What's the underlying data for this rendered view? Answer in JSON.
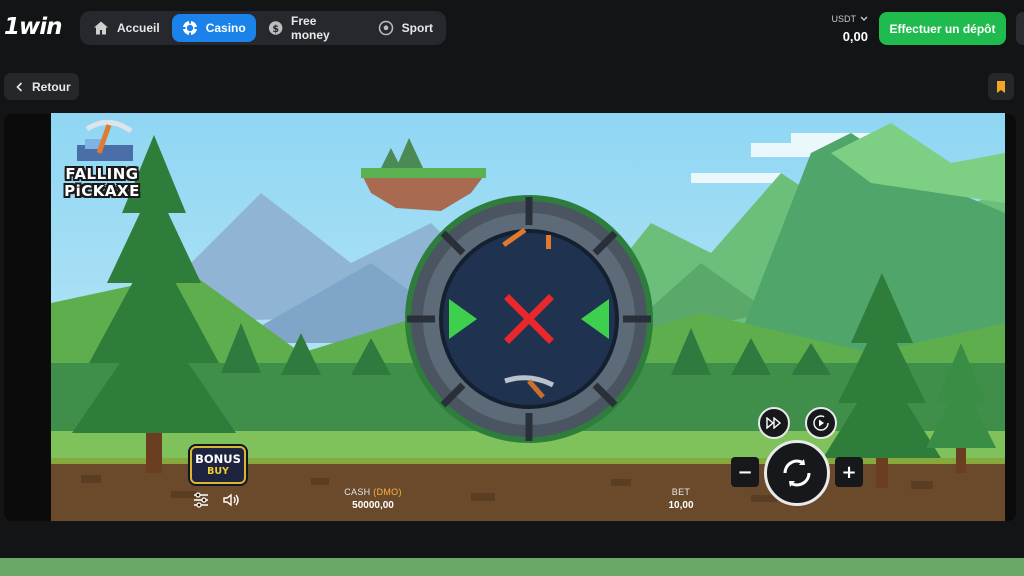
{
  "header": {
    "logo": "1win",
    "nav": [
      {
        "label": "Accueil",
        "icon": "home-icon",
        "active": false
      },
      {
        "label": "Casino",
        "icon": "casino-chip-icon",
        "active": true
      },
      {
        "label": "Free money",
        "icon": "dollar-coin-icon",
        "active": false
      },
      {
        "label": "Sport",
        "icon": "soccer-ball-icon",
        "active": false
      }
    ],
    "balance": {
      "currency": "USDT",
      "amount": "0,00"
    },
    "deposit_label": "Effectuer un dépôt"
  },
  "subbar": {
    "back_label": "Retour",
    "bookmark_icon": "bookmark-icon"
  },
  "game": {
    "logo_line1": "FALLING",
    "logo_line2": "PiCKAXE",
    "bonus_line1": "BONUS",
    "bonus_line2": "BUY",
    "cash_label": "CASH",
    "cash_mode": "(DMO)",
    "cash_value": "50000,00",
    "bet_label": "BET",
    "bet_value": "10,00",
    "colors": {
      "accent_blue": "#1b82ea",
      "deposit_green": "#1fbb4e",
      "bonus_gold": "#d8b72a"
    }
  }
}
